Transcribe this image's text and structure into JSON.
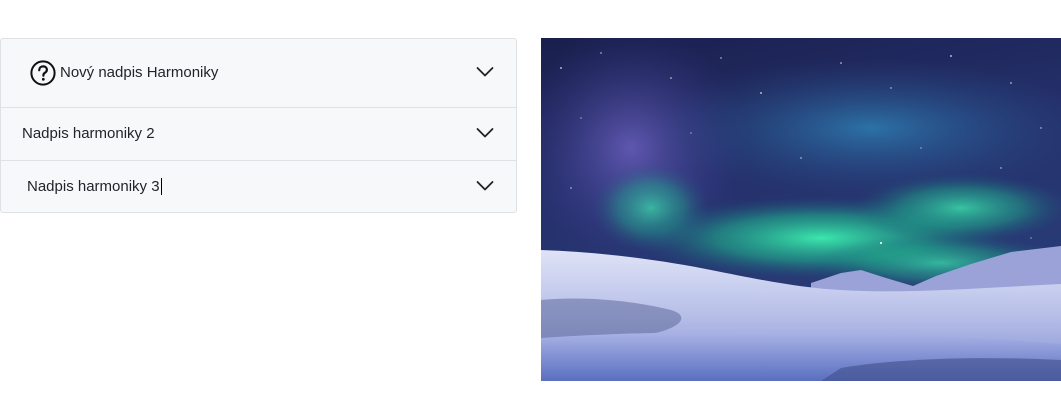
{
  "accordion": {
    "items": [
      {
        "label": "Nový nadpis Harmoniky",
        "icon": "help-circle-icon",
        "expanded": false
      },
      {
        "label": "Nadpis harmoniky 2",
        "expanded": false
      },
      {
        "label": "Nadpis harmoniky 3",
        "expanded": false,
        "editing": true
      }
    ]
  },
  "image": {
    "subject": "aurora-borealis-over-snowy-hills"
  },
  "colors": {
    "header_bg": "#f7f8fa",
    "border": "#dfe1e4",
    "text": "#212529",
    "sky_dark": "#1b2353",
    "aurora_green": "#2ee6a6",
    "snow": "#c9d0f0"
  }
}
